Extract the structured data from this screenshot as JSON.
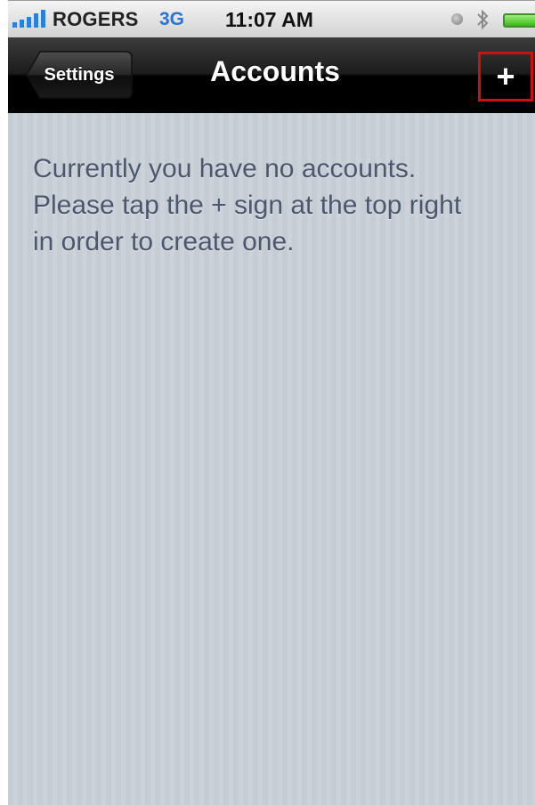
{
  "status_bar": {
    "carrier": "ROGERS",
    "network": "3G",
    "time": "11:07 AM",
    "icons": [
      "signal-bars-icon",
      "lock-icon",
      "bluetooth-icon",
      "battery-icon"
    ]
  },
  "nav": {
    "back_label": "Settings",
    "title": "Accounts",
    "add_label": "+"
  },
  "content": {
    "message_lines": [
      "Currently you have no accounts.",
      "Please tap the + sign at the top right",
      "in order to create one."
    ]
  },
  "colors": {
    "network": "#2a74d8",
    "highlight_border": "#d01010",
    "message_text": "#4c566c",
    "background": "#c5ccd4"
  }
}
